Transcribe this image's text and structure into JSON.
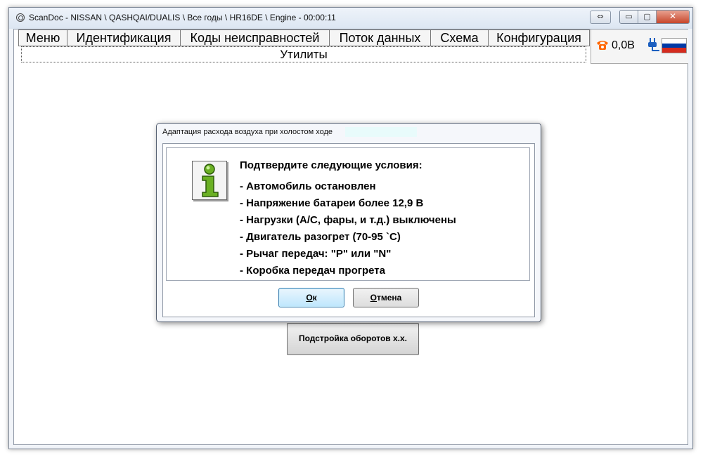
{
  "window": {
    "title": "ScanDoc - NISSAN \\ QASHQAI/DUALIS \\ Все годы \\ HR16DE \\ Engine - 00:00:11",
    "restore_glyph": "⇔",
    "min_glyph": "▭",
    "max_glyph": "▢",
    "close_glyph": "✕"
  },
  "menu": {
    "items": [
      {
        "label": "Меню"
      },
      {
        "label": "Идентификация"
      },
      {
        "label": "Коды неисправностей"
      },
      {
        "label": "Поток данных"
      },
      {
        "label": "Схема"
      },
      {
        "label": "Конфигурация"
      }
    ],
    "utilities_label": "Утилиты"
  },
  "status": {
    "voltage": "0,0В",
    "icons": [
      "phone-icon",
      "plug-icon",
      "russia-flag"
    ],
    "colors": {
      "phone": "#ff6600",
      "plug": "#1c5fc0"
    }
  },
  "background_button": {
    "label": "Подстройка оборотов х.х."
  },
  "dialog": {
    "title": "Адаптация расхода воздуха при холостом ходе",
    "heading": "Подтвердите следующие условия:",
    "conditions": [
      "- Автомобиль остановлен",
      "- Напряжение батареи более 12,9 В",
      "- Нагрузки (A/C, фары, и т.д.) выключены",
      "- Двигатель разогрет  (70-95 `C)",
      "- Рычаг передач: \"P\" или \"N\"",
      "- Коробка передач прогрета"
    ],
    "ok": {
      "first": "О",
      "rest": "к"
    },
    "cancel": {
      "first": "О",
      "rest": "тмена"
    },
    "icon": "info-icon",
    "icon_color": "#6ab023"
  }
}
